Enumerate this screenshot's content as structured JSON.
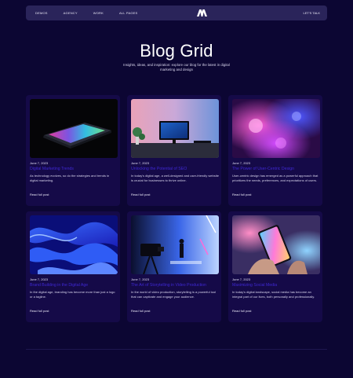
{
  "nav": {
    "links": [
      "DEMOS",
      "AGENCY",
      "WORK",
      "ALL PAGES"
    ],
    "cta": "LET'S TALK",
    "logo_icon": "m-brand-logo"
  },
  "hero": {
    "title": "Blog Grid",
    "subtitle": "Insights, ideas, and inspiration: explore our blog for the latest in digital marketing and design"
  },
  "colors": {
    "background": "#0c0633",
    "nav": "#2a245a",
    "card": "#150a48",
    "accent": "#3f28d4"
  },
  "posts": [
    {
      "date": "June 7, 2023",
      "title": "Digital Marketing Trends",
      "excerpt": "As technology evolves, so do the strategies and trends in digital marketing.",
      "link": "Read full post",
      "image": "laptop-rgb-keyboard"
    },
    {
      "date": "June 7, 2023",
      "title": "Unlocking the Potential of SEO",
      "excerpt": "In today's digital age, a well-designed and user-friendly website is crucial for businesses to thrive online.",
      "link": "Read full post",
      "image": "desk-monitor-setup"
    },
    {
      "date": "June 7, 2023",
      "title": "The Power of User-Centric Design",
      "excerpt": "User-centric design has emerged as a powerful approach that prioritizes the needs, preferences, and expectations of users.",
      "link": "Read full post",
      "image": "neon-bokeh-lights"
    },
    {
      "date": "June 7, 2023",
      "title": "Brand Building in the Digital Age",
      "excerpt": "In the digital age, branding has become more than just a logo or a tagline.",
      "link": "Read full post",
      "image": "blue-abstract-waves"
    },
    {
      "date": "June 7, 2023",
      "title": "The Art of Storytelling in Video Production",
      "excerpt": "In the world of video production, storytelling is a powerful tool that can captivate and engage your audience.",
      "link": "Read full post",
      "image": "video-studio-camera"
    },
    {
      "date": "June 7, 2023",
      "title": "Maximizing Social Media",
      "excerpt": "In today's digital landscape, social media has become an integral part of our lives, both personally and professionally.",
      "link": "Read full post",
      "image": "phone-in-hand"
    }
  ]
}
